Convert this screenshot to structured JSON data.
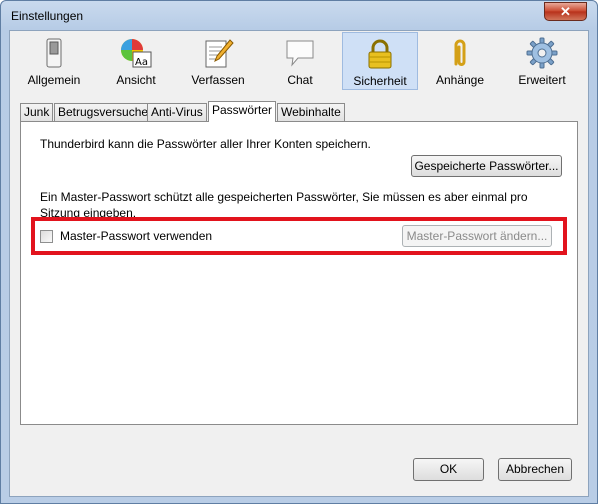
{
  "window": {
    "title": "Einstellungen",
    "close_glyph": "✕"
  },
  "toolbar": {
    "items": [
      {
        "label": "Allgemein",
        "icon": "toggle-switch-icon"
      },
      {
        "label": "Ansicht",
        "icon": "color-font-icon"
      },
      {
        "label": "Verfassen",
        "icon": "pencil-paper-icon"
      },
      {
        "label": "Chat",
        "icon": "speech-bubble-icon"
      },
      {
        "label": "Sicherheit",
        "icon": "padlock-icon",
        "selected": true
      },
      {
        "label": "Anhänge",
        "icon": "paperclip-icon"
      },
      {
        "label": "Erweitert",
        "icon": "gear-icon"
      }
    ]
  },
  "tabs": {
    "items": [
      "Junk",
      "Betrugsversuche",
      "Anti-Virus",
      "Passwörter",
      "Webinhalte"
    ],
    "active": "Passwörter"
  },
  "passwords": {
    "description": "Thunderbird kann die Passwörter aller Ihrer Konten speichern.",
    "saved_button": "Gespeicherte Passwörter...",
    "master_info": "Ein Master-Passwort schützt alle gespeicherten Passwörter, Sie müssen es aber einmal pro Sitzung eingeben.",
    "use_master_label": "Master-Passwort verwenden",
    "use_master_checked": false,
    "change_master_button": "Master-Passwort ändern..."
  },
  "footer": {
    "ok": "OK",
    "cancel": "Abbrechen"
  },
  "colors": {
    "highlight": "#e2131d",
    "selected_pane": "#cfe0f6"
  }
}
